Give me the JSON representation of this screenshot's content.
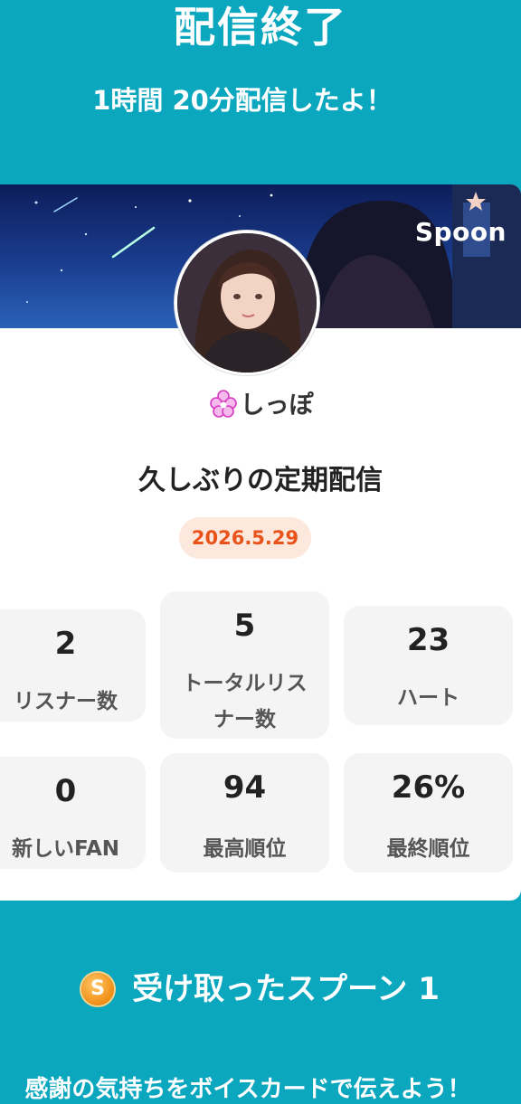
{
  "header": {
    "title": "配信終了",
    "subtitle": "1時間 20分配信したよ！"
  },
  "banner": {
    "brand": "Spoon"
  },
  "profile": {
    "icon": "flower-icon",
    "name": "しっぽ"
  },
  "live": {
    "title": "久しぶりの定期配信",
    "date": "2026.5.29"
  },
  "stats": [
    {
      "value": "2",
      "label": "リスナー数"
    },
    {
      "value": "5",
      "label_line1": "トータルリス",
      "label_line2": "ナー数"
    },
    {
      "value": "23",
      "label": "ハート"
    },
    {
      "value": "0",
      "label": "新しいFAN"
    },
    {
      "value": "94",
      "label": "最高順位"
    },
    {
      "value": "26%",
      "label": "最終順位"
    }
  ],
  "spoons": {
    "icon": "spoon-coin-icon",
    "text": "受け取ったスプーン 1"
  },
  "footer": {
    "text": "感謝の気持ちをボイスカードで伝えよう！"
  },
  "colors": {
    "background": "#0aa7bf",
    "date_badge_bg": "#fde8dd",
    "date_badge_text": "#e8521b",
    "stat_card_bg": "#f4f4f4"
  }
}
